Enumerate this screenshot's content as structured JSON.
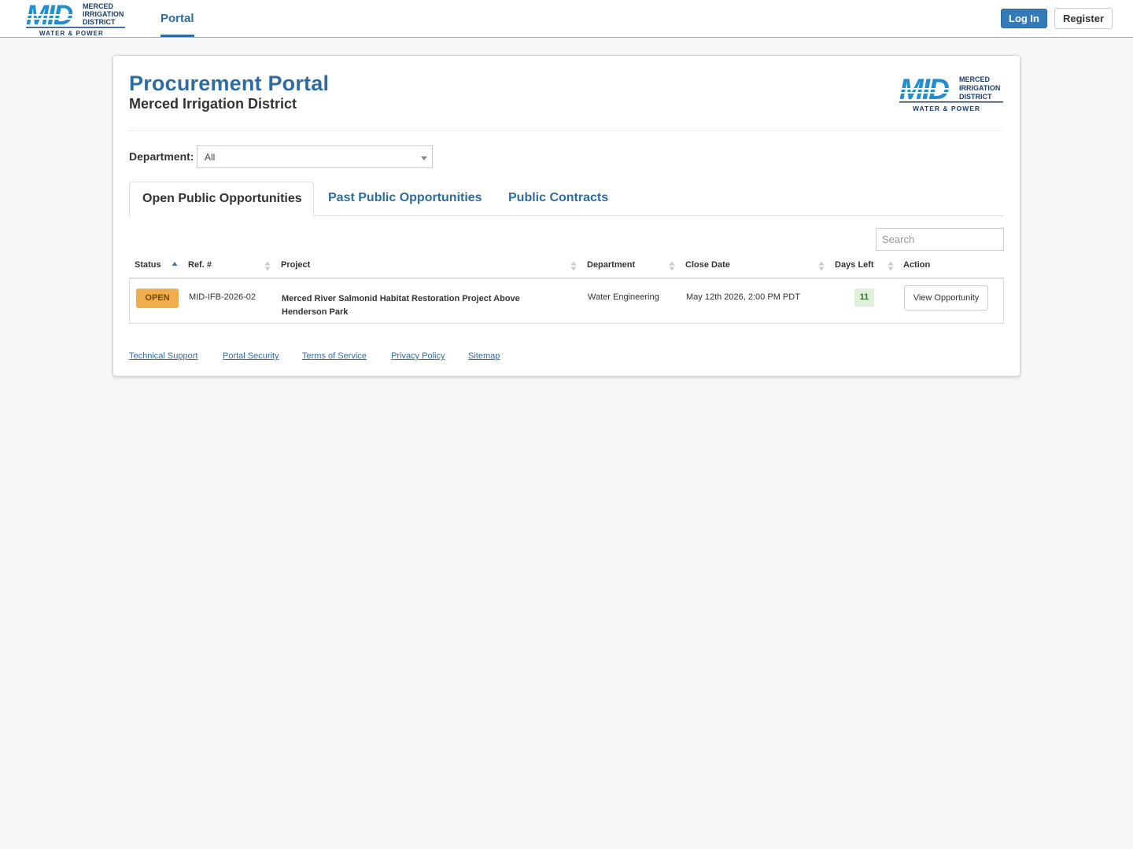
{
  "logo": {
    "letters": "MID",
    "line1": "MERCED",
    "line2": "IRRIGATION",
    "line3": "DISTRICT",
    "tagline": "WATER & POWER"
  },
  "nav": {
    "portal_link": "Portal",
    "login_label": "Log In",
    "register_label": "Register"
  },
  "header": {
    "title": "Procurement Portal",
    "subtitle": "Merced Irrigation District"
  },
  "filter": {
    "department_label": "Department:",
    "department_value": "All"
  },
  "tabs": [
    {
      "label": "Open Public Opportunities",
      "active": true
    },
    {
      "label": "Past Public Opportunities",
      "active": false
    },
    {
      "label": "Public Contracts",
      "active": false
    }
  ],
  "search": {
    "placeholder": "Search"
  },
  "table": {
    "columns": [
      "Status",
      "Ref. #",
      "Project",
      "Department",
      "Close Date",
      "Days Left",
      "Action"
    ],
    "sorted_column": "Status",
    "rows": [
      {
        "status": "OPEN",
        "ref": "MID-IFB-2026-02",
        "project": "Merced River Salmonid Habitat Restoration Project Above Henderson Park",
        "department": "Water Engineering",
        "close_date": "May 12th 2026, 2:00 PM PDT",
        "days_left": "11",
        "action": "View Opportunity"
      }
    ]
  },
  "footer": {
    "links": [
      "Technical Support",
      "Portal Security",
      "Terms of Service",
      "Privacy Policy",
      "Sitemap"
    ]
  },
  "colors": {
    "brand_blue": "#2e6da4",
    "logo_blue": "#1f8fd0",
    "logo_navy": "#1a3f6f",
    "open_badge": "#f0ad4e",
    "days_left_badge": "#dff0d8"
  }
}
